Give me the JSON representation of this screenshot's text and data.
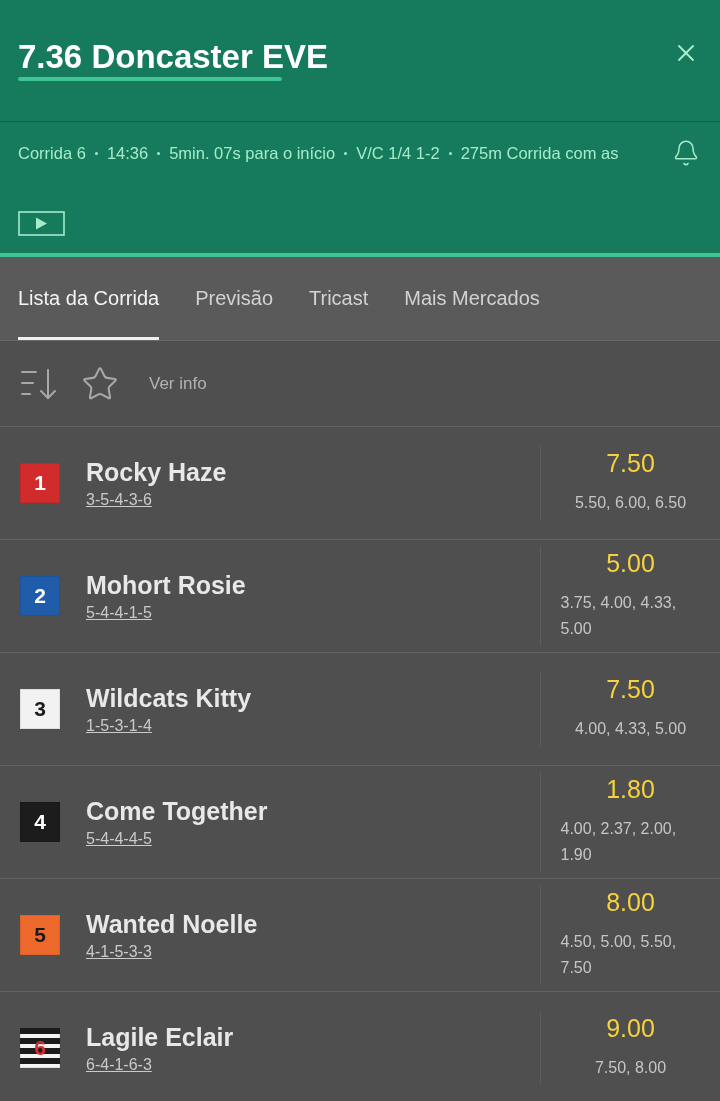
{
  "header": {
    "title": "7.36 Doncaster EVE",
    "info": [
      "Corrida 6",
      "14:36",
      "5min. 07s para o início",
      "V/C 1/4 1-2",
      "275m Corrida com as"
    ]
  },
  "tabs": [
    {
      "label": "Lista da Corrida",
      "selected": true
    },
    {
      "label": "Previsão",
      "selected": false
    },
    {
      "label": "Tricast",
      "selected": false
    },
    {
      "label": "Mais Mercados",
      "selected": false
    }
  ],
  "toolbar": {
    "info_link": "Ver info"
  },
  "runners": [
    {
      "number": "1",
      "kind": "solid",
      "color": "#d22b2b",
      "name": "Rocky Haze",
      "form": "3-5-4-3-6",
      "price": "7.50",
      "price_history": "5.50, 6.00, 6.50"
    },
    {
      "number": "2",
      "kind": "solid",
      "color": "#1f5dab",
      "name": "Mohort Rosie",
      "form": "5-4-4-1-5",
      "price": "5.00",
      "price_history": "3.75, 4.00, 4.33, 5.00"
    },
    {
      "number": "3",
      "kind": "solid",
      "color": "#f2f2f2",
      "name": "Wildcats Kitty",
      "form": "1-5-3-1-4",
      "price": "7.50",
      "price_history": "4.00, 4.33, 5.00"
    },
    {
      "number": "4",
      "kind": "solid",
      "color": "#1c1c1c",
      "name": "Come Together",
      "form": "5-4-4-4-5",
      "price": "1.80",
      "price_history": "4.00, 2.37, 2.00, 1.90"
    },
    {
      "number": "5",
      "kind": "solid",
      "color": "#ee6a2c",
      "name": "Wanted Noelle",
      "form": "4-1-5-3-3",
      "price": "8.00",
      "price_history": "4.50, 5.00, 5.50, 7.50"
    },
    {
      "number": "6",
      "kind": "striped",
      "color": "#1c1c1c",
      "name": "Lagile Eclair",
      "form": "6-4-1-6-3",
      "price": "9.00",
      "price_history": "7.50, 8.00"
    }
  ]
}
